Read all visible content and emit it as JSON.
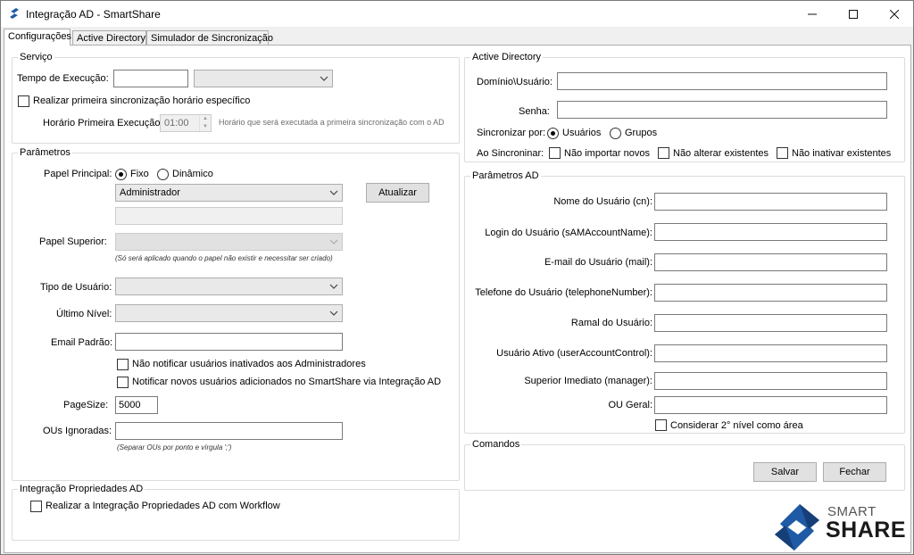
{
  "window": {
    "title": "Integração AD - SmartShare",
    "minimize_icon": "minimize-icon",
    "maximize_icon": "maximize-icon",
    "close_icon": "close-icon"
  },
  "tabs": [
    {
      "label": "Configurações",
      "active": true
    },
    {
      "label": "Active Directory",
      "active": false
    },
    {
      "label": "Simulador de Sincronização",
      "active": false
    }
  ],
  "servico": {
    "title": "Serviço",
    "tempo_label": "Tempo de Execução:",
    "tempo_value": "",
    "unidade_value": "",
    "realizar_label": "Realizar primeira sincronização horário específico",
    "realizar_checked": false,
    "horario_label": "Horário Primeira Execução:",
    "horario_value": "01:00",
    "horario_hint": "Horário que será executada a primeira sincronização com o AD"
  },
  "parametros": {
    "title": "Parâmetros",
    "papel_principal_label": "Papel Principal:",
    "fixo_label": "Fixo",
    "dinamico_label": "Dinâmico",
    "papel_selected": "Fixo",
    "papel_value": "Administrador",
    "papel_text": "",
    "atualizar_label": "Atualizar",
    "papel_superior_label": "Papel Superior:",
    "papel_superior_value": "",
    "papel_superior_hint": "(Só será aplicado quando o papel não existir e necessitar ser criado)",
    "tipo_usuario_label": "Tipo de Usuário:",
    "tipo_usuario_value": "",
    "ultimo_nivel_label": "Último Nível:",
    "ultimo_nivel_value": "",
    "email_label": "Email Padrão:",
    "email_value": "",
    "nao_notificar_label": "Não notificar usuários inativados aos Administradores",
    "notificar_novos_label": "Notificar novos usuários adicionados no SmartShare via Integração AD",
    "pagesize_label": "PageSize:",
    "pagesize_value": "5000",
    "ous_label": "OUs Ignoradas:",
    "ous_value": "",
    "ous_hint": "(Separar OUs por ponto e vírgula ';')"
  },
  "integracao": {
    "title": "Integração Propriedades AD",
    "realizar_label": "Realizar a Integração Propriedades AD com Workflow"
  },
  "active_directory": {
    "title": "Active Directory",
    "dominio_label": "Domínio\\Usuário:",
    "dominio_value": "",
    "senha_label": "Senha:",
    "senha_value": "",
    "sincronizar_label": "Sincronizar por:",
    "usuarios_label": "Usuários",
    "grupos_label": "Grupos",
    "sincronizar_selected": "Usuários",
    "ao_sincronizar_label": "Ao Sincroninar:",
    "nao_importar_label": "Não importar novos",
    "nao_alterar_label": "Não alterar existentes",
    "nao_inativar_label": "Não inativar existentes"
  },
  "parametros_ad": {
    "title": "Parâmetros AD",
    "fields": [
      {
        "label": "Nome do Usuário (cn):",
        "value": ""
      },
      {
        "label": "Login do Usuário (sAMAccountName):",
        "value": ""
      },
      {
        "label": "E-mail do Usuário (mail):",
        "value": ""
      },
      {
        "label": "Telefone do Usuário (telephoneNumber):",
        "value": ""
      },
      {
        "label": "Ramal do Usuário:",
        "value": ""
      },
      {
        "label": "Usuário Ativo (userAccountControl):",
        "value": ""
      },
      {
        "label": "Superior Imediato (manager):",
        "value": ""
      },
      {
        "label": "OU Geral:",
        "value": ""
      }
    ],
    "considerar_label": "Considerar 2° nível como área"
  },
  "comandos": {
    "title": "Comandos",
    "salvar_label": "Salvar",
    "fechar_label": "Fechar"
  },
  "logo": {
    "line1": "SMART",
    "line2": "SHARE",
    "brand_color": "#1f5aa6"
  }
}
